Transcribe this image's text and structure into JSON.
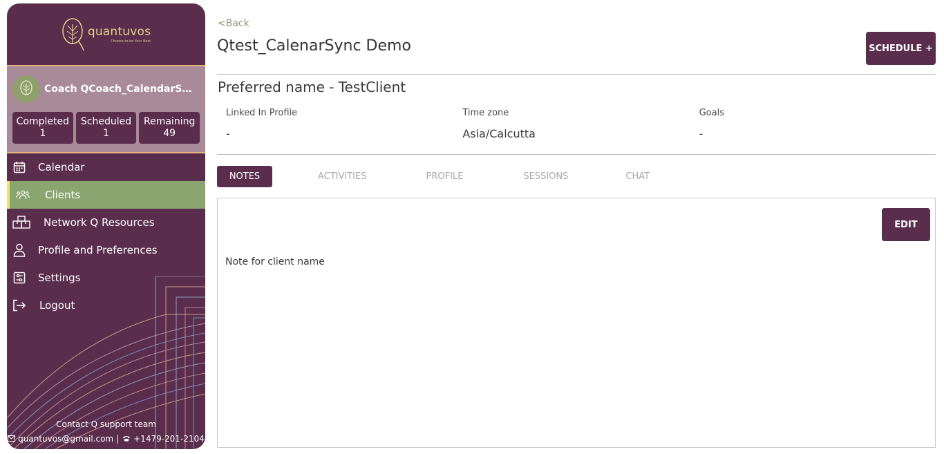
{
  "brand": {
    "name": "quantuvos",
    "tagline": "Choose to be Your Best"
  },
  "coach": {
    "name": "Coach QCoach_CalendarSync'..."
  },
  "stats": [
    {
      "label": "Completed",
      "value": "1"
    },
    {
      "label": "Scheduled",
      "value": "1"
    },
    {
      "label": "Remaining",
      "value": "49"
    }
  ],
  "menu": [
    {
      "label": "Calendar",
      "icon": "calendar-icon"
    },
    {
      "label": "Clients",
      "icon": "users-icon",
      "active": true
    },
    {
      "label": "Network Q Resources",
      "icon": "network-icon"
    },
    {
      "label": "Profile and Preferences",
      "icon": "user-icon"
    },
    {
      "label": "Settings",
      "icon": "settings-icon"
    },
    {
      "label": "Logout",
      "icon": "logout-icon"
    }
  ],
  "support": {
    "title": "Contact Q support team",
    "email": "quantuvos@gmail.com",
    "phone": "+1479-201-2104"
  },
  "main": {
    "back_label": "<Back",
    "client_title": "Qtest_CalenarSync Demo",
    "schedule_label": "SCHEDULE +",
    "preferred_name": "Preferred name  - TestClient",
    "info": [
      {
        "label": "Linked In Profile",
        "value": "-"
      },
      {
        "label": "Time zone",
        "value": "Asia/Calcutta"
      },
      {
        "label": "Goals",
        "value": "-"
      }
    ],
    "tabs": [
      "NOTES",
      "ACTIVITIES",
      "PROFILE",
      "SESSIONS",
      "CHAT"
    ],
    "active_tab": "NOTES",
    "edit_label": "EDIT",
    "note_text": "Note for client name"
  },
  "colors": {
    "primary": "#5a2d4d",
    "active_menu": "#8aa56f",
    "coach_box": "#a98a99",
    "accent_line": "#e8b27c",
    "back_link": "#8a9a73"
  }
}
